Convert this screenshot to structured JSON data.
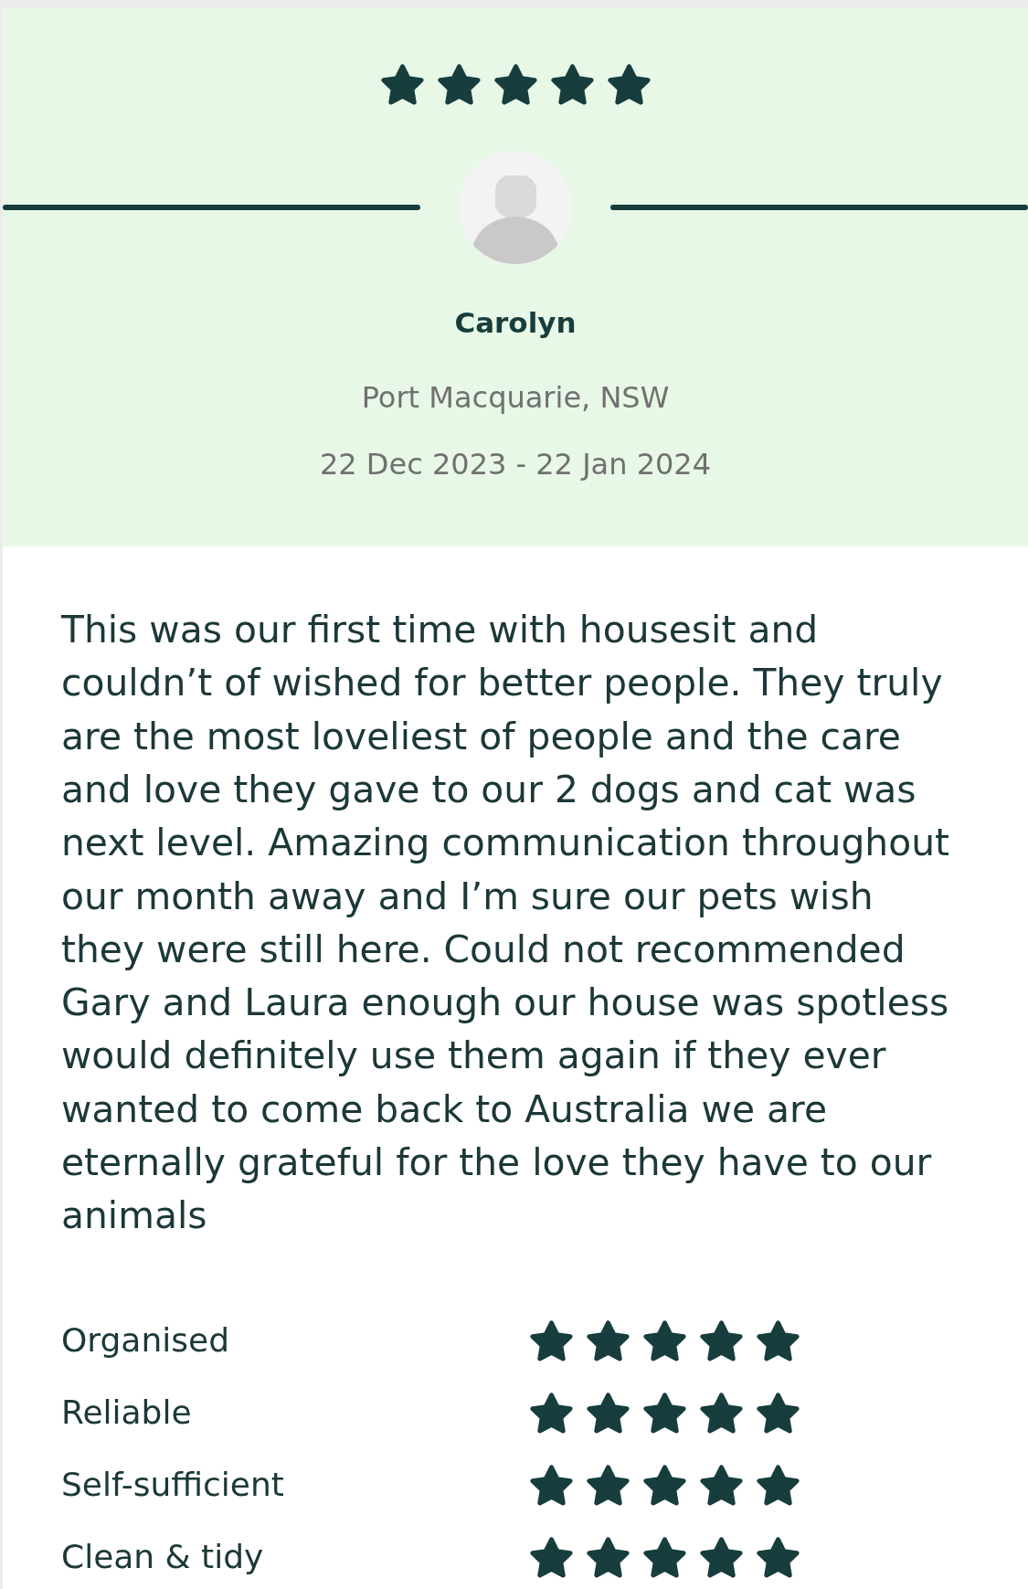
{
  "review": {
    "stars": 5,
    "reviewer": {
      "name": "Carolyn",
      "location": "Port Macquarie, NSW"
    },
    "dates": "22 Dec 2023 - 22 Jan 2024"
  },
  "comment": "This was our first time with housesit and couldn’t of wished for better people. They truly are the most loveliest of people and the care and love they gave to our 2 dogs and cat was next level. Amazing communication throughout our month away and I’m sure our pets wish they were still here. Could not recommended Gary and Laura enough our house was spotless would definitely use them again if they ever wanted to come back to Australia we are eternally grateful for the love they have to our animals",
  "ratings": [
    {
      "label": "Organised",
      "stars": 5
    },
    {
      "label": "Reliable",
      "stars": 5
    },
    {
      "label": "Self-sufficient",
      "stars": 5
    },
    {
      "label": "Clean & tidy",
      "stars": 5
    }
  ]
}
